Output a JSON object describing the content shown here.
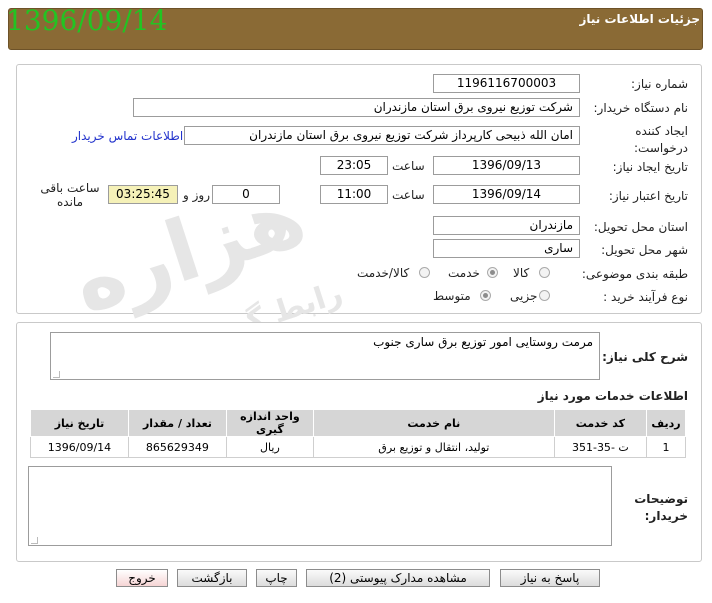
{
  "header": {
    "title": "جزئیات اطلاعات نیاز",
    "date": "1396/09/14"
  },
  "form": {
    "need_number": {
      "label": "شماره نیاز:",
      "value": "1196116700003"
    },
    "buyer_org": {
      "label": "نام دستگاه خریدار:",
      "value": "شرکت توزیع نیروی برق استان مازندران"
    },
    "requester": {
      "label": "ایجاد کننده درخواست:",
      "value": "امان الله ذبیحی کارپرداز شرکت توزیع نیروی برق استان مازندران",
      "contact_link": "اطلاعات تماس خریدار"
    },
    "created": {
      "label": "تاریخ ایجاد نیاز:",
      "date": "1396/09/13",
      "time_label": "ساعت",
      "time": "23:05"
    },
    "validity": {
      "label": "تاریخ اعتبار نیاز:",
      "date": "1396/09/14",
      "time_label": "ساعت",
      "time": "11:00",
      "days": "0",
      "days_label": "روز و",
      "remaining": "03:25:45",
      "remaining_label": "ساعت باقی مانده"
    },
    "province": {
      "label": "استان محل تحویل:",
      "value": "مازندران"
    },
    "city": {
      "label": "شهر محل تحویل:",
      "value": "ساری"
    },
    "category": {
      "label": "طبقه بندی موضوعی:",
      "options": [
        "کالا",
        "خدمت",
        "کالا/خدمت"
      ],
      "selected": "خدمت"
    },
    "purchase_type": {
      "label": "نوع فرآیند خرید :",
      "options": [
        "جزیی",
        "متوسط"
      ],
      "selected": "متوسط"
    }
  },
  "description": {
    "label": "شرح کلی نیاز:",
    "value": "مرمت روستایی امور توزیع برق ساری جنوب"
  },
  "services": {
    "title": "اطلاعات خدمات مورد نیاز",
    "columns": [
      "ردیف",
      "کد خدمت",
      "نام خدمت",
      "واحد اندازه گیری",
      "تعداد / مقدار",
      "تاریخ نیاز"
    ],
    "rows": [
      [
        "1",
        "ت -35-351",
        "تولید، انتقال و توزیع برق",
        "ریال",
        "865629349",
        "1396/09/14"
      ]
    ]
  },
  "buyer_notes": {
    "label": "توضیحات خریدار:",
    "value": ""
  },
  "buttons": {
    "reply": "پاسخ به نیاز",
    "attachments": "مشاهده مدارک پیوستی (2)",
    "print": "چاپ",
    "back": "بازگشت",
    "exit": "خروج"
  },
  "watermark": {
    "main": "هزاره",
    "sub": "رابط گستران"
  }
}
